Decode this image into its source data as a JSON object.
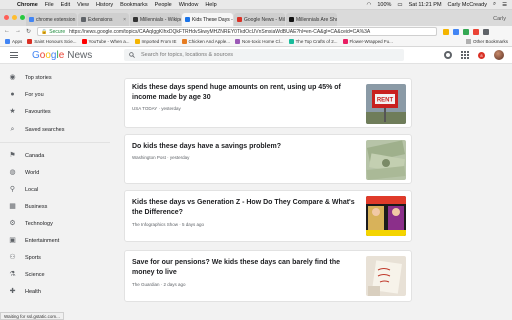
{
  "menubar": {
    "app": "Chrome",
    "items": [
      "File",
      "Edit",
      "View",
      "History",
      "Bookmarks",
      "People",
      "Window",
      "Help"
    ],
    "status": {
      "battery": "100%",
      "datetime": "Sat 11:21 PM",
      "user": "Carly McCready"
    }
  },
  "tabs": [
    {
      "label": "chrome extension th:",
      "color": "#4285f4"
    },
    {
      "label": "Extensions",
      "color": "#5f6368"
    },
    {
      "label": "Millennials - Wikipedia",
      "color": "#333333"
    },
    {
      "label": "Kids These Days - Edit",
      "color": "#1a73e8"
    },
    {
      "label": "Google News - Millenn",
      "color": "#d93025"
    },
    {
      "label": "Millennials Are Shoppi",
      "color": "#111111"
    }
  ],
  "tabbar_user": "Carly",
  "omnibox": {
    "secure_label": "Secure",
    "url": "https://news.google.com/topics/CAAqIggKIhxDQkFTRHdvSkwyMHZNREY0TkdOcUVnSmxiaWdBUAE?hl=en-CA&gl=CA&ceid=CA%3A"
  },
  "bookmarks": [
    {
      "label": "Apps",
      "color": "#4285f4"
    },
    {
      "label": "Saint Honours Scie...",
      "color": "#d93025"
    },
    {
      "label": "YouTube - When a...",
      "color": "#ff0000"
    },
    {
      "label": "Imported From IE",
      "color": "#f4b400"
    },
    {
      "label": "Chicken And Apple...",
      "color": "#e67c22"
    },
    {
      "label": "Non-toxic Home Cl...",
      "color": "#9b59b6"
    },
    {
      "label": "The Top Crafts of 2...",
      "color": "#1abc9c"
    },
    {
      "label": "Flower-Wrapped Fu...",
      "color": "#e91e63"
    }
  ],
  "bookmarks_other": "Other Bookmarks",
  "header": {
    "logo_letters": [
      {
        "ch": "G",
        "color": "#4285f4"
      },
      {
        "ch": "o",
        "color": "#ea4335"
      },
      {
        "ch": "o",
        "color": "#fbbc05"
      },
      {
        "ch": "g",
        "color": "#4285f4"
      },
      {
        "ch": "l",
        "color": "#34a853"
      },
      {
        "ch": "e",
        "color": "#ea4335"
      }
    ],
    "logo_news": "News",
    "search_placeholder": "Search for topics, locations & sources",
    "notif_count": "8"
  },
  "sidebar": [
    {
      "label": "Top stories",
      "icon": "globe-icon",
      "glyph": "◉"
    },
    {
      "label": "For you",
      "icon": "person-icon",
      "glyph": "●"
    },
    {
      "label": "Favourites",
      "icon": "star-icon",
      "glyph": "★"
    },
    {
      "label": "Saved searches",
      "icon": "search-icon",
      "glyph": "⌕"
    },
    {
      "label": "Canada",
      "icon": "flag-icon",
      "glyph": "⚑"
    },
    {
      "label": "World",
      "icon": "world-icon",
      "glyph": "◍"
    },
    {
      "label": "Local",
      "icon": "location-pin-icon",
      "glyph": "⚲"
    },
    {
      "label": "Business",
      "icon": "building-icon",
      "glyph": "▦"
    },
    {
      "label": "Technology",
      "icon": "chip-icon",
      "glyph": "⚙"
    },
    {
      "label": "Entertainment",
      "icon": "film-icon",
      "glyph": "▣"
    },
    {
      "label": "Sports",
      "icon": "bike-icon",
      "glyph": "⚇"
    },
    {
      "label": "Science",
      "icon": "flask-icon",
      "glyph": "⚗"
    },
    {
      "label": "Health",
      "icon": "health-icon",
      "glyph": "✚"
    }
  ],
  "cards": [
    {
      "title": "Kids these days spend huge amounts on rent, using up 45% of income made by age 30",
      "source": "USA TODAY",
      "time": "yesterday",
      "thumb": "for-rent-sign"
    },
    {
      "title": "Do kids these days have a savings problem?",
      "source": "Washington Post",
      "time": "yesterday",
      "thumb": "dollar-bills"
    },
    {
      "title": "Kids these days vs Generation Z - How Do They Compare & What's the Difference?",
      "source": "The Infographics Show",
      "time": "5 days ago",
      "thumb": "video-thumbnail"
    },
    {
      "title": "Save for our pensions? We kids these days can barely find the money to live",
      "source": "The Guardian",
      "time": "2 days ago",
      "thumb": "note-paper"
    }
  ],
  "status_url": "Waiting for ssl.gstatic.com..."
}
